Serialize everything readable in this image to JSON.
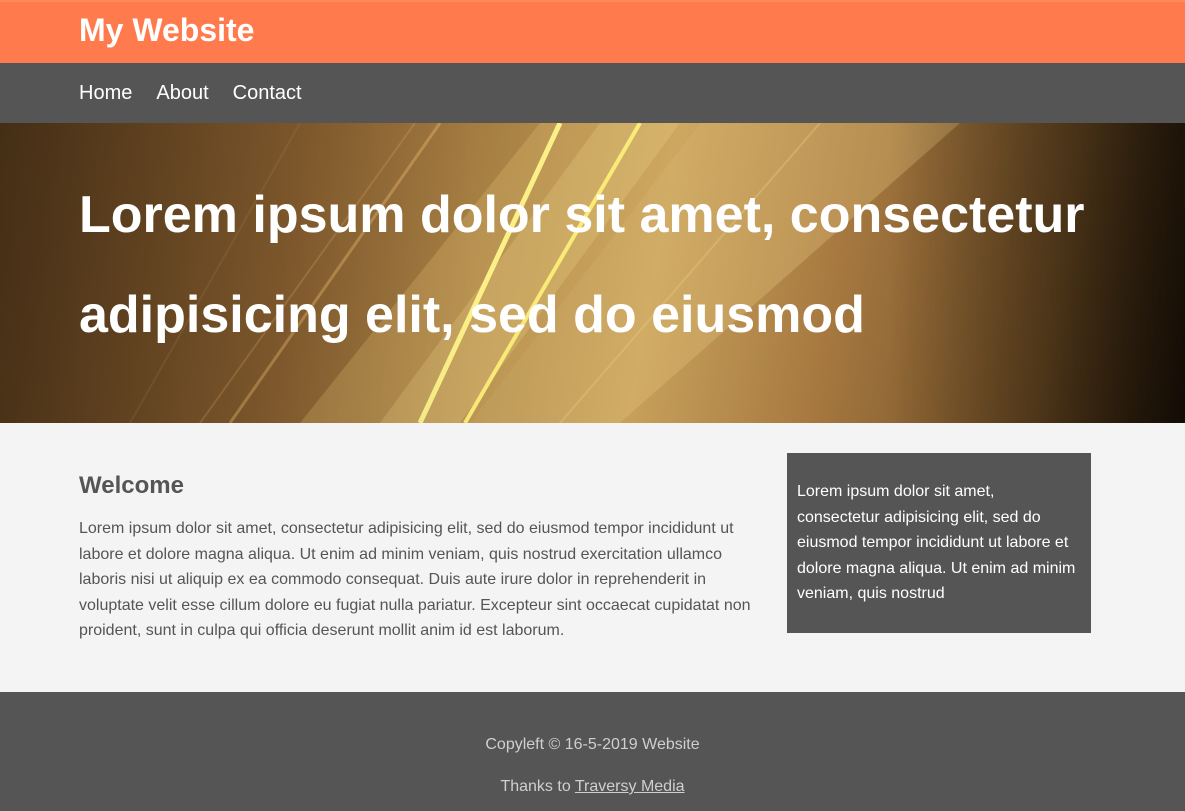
{
  "header": {
    "title": "My Website"
  },
  "nav": {
    "items": [
      {
        "label": "Home"
      },
      {
        "label": "About"
      },
      {
        "label": "Contact"
      }
    ]
  },
  "hero": {
    "heading": "Lorem ipsum dolor sit amet, consectetur adipisicing elit, sed do eiusmod"
  },
  "main": {
    "heading": "Welcome",
    "body": "Lorem ipsum dolor sit amet, consectetur adipisicing elit, sed do eiusmod tempor incididunt ut labore et dolore magna aliqua. Ut enim ad minim veniam, quis nostrud exercitation ullamco laboris nisi ut aliquip ex ea commodo consequat. Duis aute irure dolor in reprehenderit in voluptate velit esse cillum dolore eu fugiat nulla pariatur. Excepteur sint occaecat cupidatat non proident, sunt in culpa qui officia deserunt mollit anim id est laborum."
  },
  "sidebar": {
    "text": "Lorem ipsum dolor sit amet, consectetur adipisicing elit, sed do eiusmod tempor incididunt ut labore et dolore magna aliqua. Ut enim ad minim veniam, quis nostrud"
  },
  "footer": {
    "copyright": "Copyleft © 16-5-2019 Website",
    "thanks_prefix": "Thanks to ",
    "thanks_link": "Traversy Media"
  },
  "colors": {
    "header_bg": "#ff7b4d",
    "nav_bg": "#555555",
    "page_bg": "#f4f4f4",
    "footer_bg": "#555555"
  }
}
